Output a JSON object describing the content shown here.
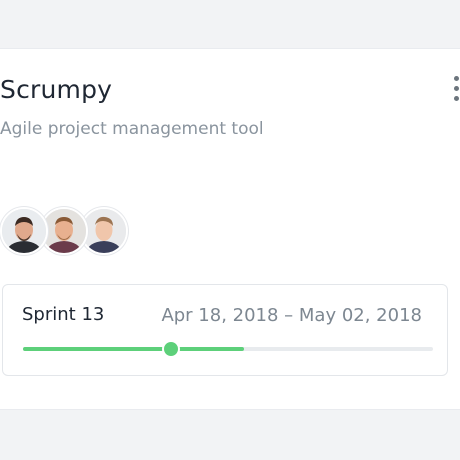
{
  "project": {
    "title": "Scrumpy",
    "subtitle": "Agile project management tool",
    "menu_icon": "more-vertical-icon"
  },
  "members": [
    {
      "name": "member-1",
      "icon": "avatar"
    },
    {
      "name": "member-2",
      "icon": "avatar"
    },
    {
      "name": "member-3",
      "icon": "avatar"
    }
  ],
  "sprint": {
    "name": "Sprint 13",
    "dates": "Apr 18, 2018 – May 02, 2018",
    "progress_fraction": 0.54,
    "today_fraction": 0.355
  },
  "colors": {
    "progress": "#5dd07a",
    "track": "#e8ebee"
  }
}
